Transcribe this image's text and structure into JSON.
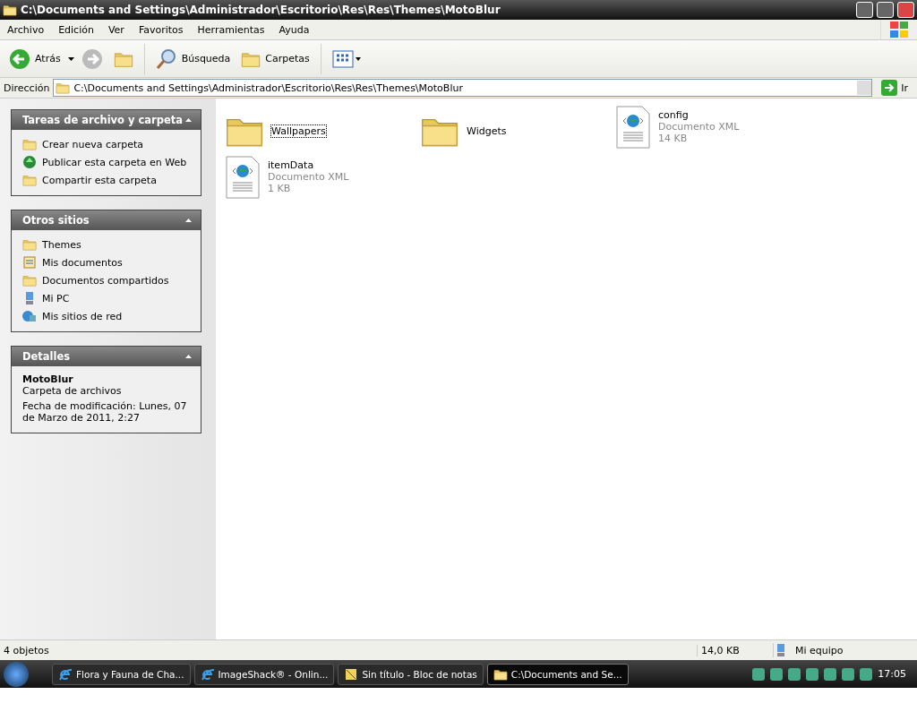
{
  "window": {
    "title": "C:\\Documents and Settings\\Administrador\\Escritorio\\Res\\Res\\Themes\\MotoBlur"
  },
  "menu": [
    "Archivo",
    "Edición",
    "Ver",
    "Favoritos",
    "Herramientas",
    "Ayuda"
  ],
  "toolbar": {
    "back": "Atrás",
    "search": "Búsqueda",
    "folders": "Carpetas"
  },
  "address": {
    "label": "Dirección",
    "value": "C:\\Documents and Settings\\Administrador\\Escritorio\\Res\\Res\\Themes\\MotoBlur",
    "go": "Ir"
  },
  "sidebar": [
    {
      "title": "Tareas de archivo y carpeta",
      "items": [
        {
          "label": "Crear nueva carpeta",
          "kind": "newfolder"
        },
        {
          "label": "Publicar esta carpeta en Web",
          "kind": "publish"
        },
        {
          "label": "Compartir esta carpeta",
          "kind": "share"
        }
      ]
    },
    {
      "title": "Otros sitios",
      "items": [
        {
          "label": "Themes",
          "kind": "folder"
        },
        {
          "label": "Mis documentos",
          "kind": "docs"
        },
        {
          "label": "Documentos compartidos",
          "kind": "folder"
        },
        {
          "label": "Mi PC",
          "kind": "pc"
        },
        {
          "label": "Mis sitios de red",
          "kind": "network"
        }
      ]
    }
  ],
  "details": {
    "title": "Detalles",
    "name": "MotoBlur",
    "type": "Carpeta de archivos",
    "modified": "Fecha de modificación: Lunes, 07 de Marzo de 2011, 2:27"
  },
  "files": [
    {
      "name": "Wallpapers",
      "kind": "folder",
      "selected": true
    },
    {
      "name": "Widgets",
      "kind": "folder",
      "selected": false
    },
    {
      "name": "config",
      "kind": "xml",
      "type": "Documento XML",
      "size": "14 KB",
      "selected": false
    },
    {
      "name": "itemData",
      "kind": "xml",
      "type": "Documento XML",
      "size": "1 KB",
      "selected": false
    }
  ],
  "status_bar": {
    "count": "4 objetos",
    "size": "14,0 KB",
    "zone": "Mi equipo"
  },
  "taskbar": {
    "buttons": [
      {
        "label": "Flora y Fauna de Cha...",
        "kind": "ie",
        "selected": false
      },
      {
        "label": "ImageShack® - Onlin...",
        "kind": "ie",
        "selected": false
      },
      {
        "label": "Sin título - Bloc de notas",
        "kind": "notepad",
        "selected": false
      },
      {
        "label": "C:\\Documents and Se...",
        "kind": "folder",
        "selected": true
      }
    ],
    "clock": "17:05"
  }
}
